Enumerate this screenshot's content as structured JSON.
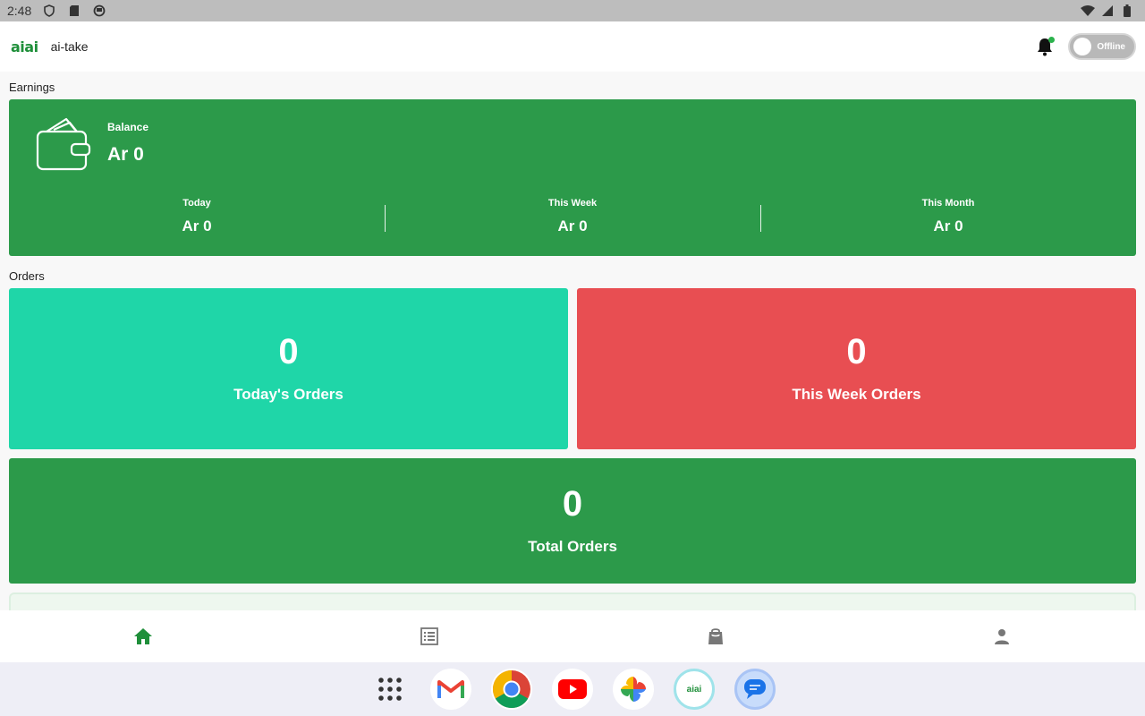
{
  "status_bar": {
    "time": "2:48",
    "left_icons": [
      "shield-icon",
      "sd-card-icon",
      "circle-app-icon"
    ],
    "right_icons": [
      "wifi-icon",
      "signal-icon",
      "battery-icon"
    ]
  },
  "app_bar": {
    "logo_text": "aiai",
    "app_name": "ai-take",
    "notification_icon": "bell-icon",
    "status_toggle_label": "Offline"
  },
  "earnings": {
    "section_title": "Earnings",
    "balance_label": "Balance",
    "balance_value": "Ar 0",
    "periods": [
      {
        "label": "Today",
        "value": "Ar 0"
      },
      {
        "label": "This Week",
        "value": "Ar 0"
      },
      {
        "label": "This Month",
        "value": "Ar 0"
      }
    ]
  },
  "orders": {
    "section_title": "Orders",
    "today": {
      "count": "0",
      "label": "Today's Orders"
    },
    "week": {
      "count": "0",
      "label": "This Week Orders"
    },
    "total": {
      "count": "0",
      "label": "Total Orders"
    }
  },
  "bottom_nav": {
    "items": [
      "home-icon",
      "list-icon",
      "bag-icon",
      "person-icon"
    ],
    "active": "home-icon"
  },
  "dock": {
    "apps": [
      "app-drawer-icon",
      "gmail-icon",
      "chrome-icon",
      "youtube-icon",
      "photos-icon",
      "aiai-app-icon",
      "messages-icon"
    ],
    "aiai_label": "aiai"
  },
  "colors": {
    "primary_green": "#2c9a4a",
    "teal": "#1fd6a8",
    "red": "#e84e52",
    "status_bar": "#bdbdbd"
  }
}
